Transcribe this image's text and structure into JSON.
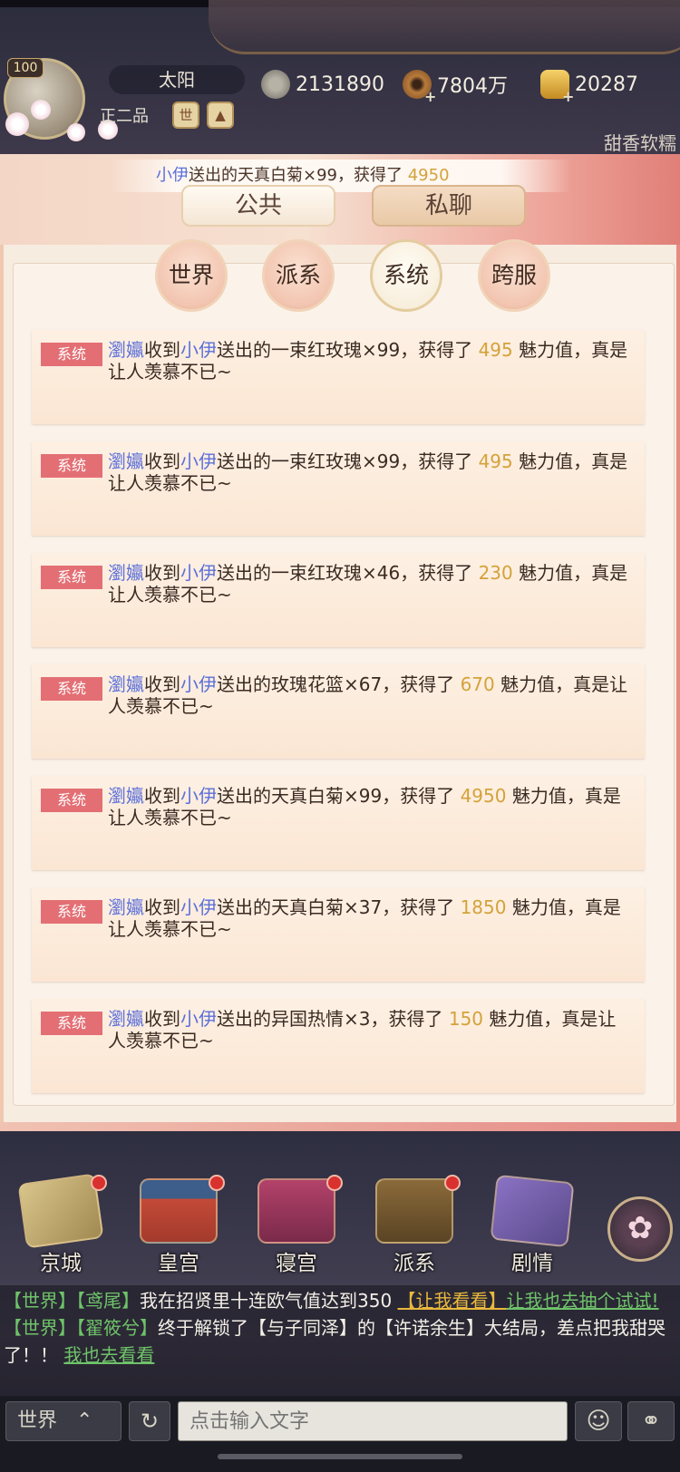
{
  "hud": {
    "level": "100",
    "player_name": "太阳",
    "rank": "正二品",
    "rank_button": "世",
    "rank_up_icon": "up-arrow-icon",
    "silver": "2131890",
    "coins": "7804万",
    "gold": "20287",
    "server": "甜香软糯"
  },
  "ticker": {
    "sender": "小伊",
    "text": "送出的天真白菊×99，获得了",
    "value": "4950"
  },
  "tabs": {
    "public": "公共",
    "private": "私聊"
  },
  "subtabs": [
    {
      "label": "世界",
      "active": false
    },
    {
      "label": "派系",
      "active": false
    },
    {
      "label": "系统",
      "active": true
    },
    {
      "label": "跨服",
      "active": false
    }
  ],
  "messages": [
    {
      "tag": "系统",
      "recipient": "瀏㜲",
      "verb": "收到",
      "sender": "小伊",
      "body": "送出的一束红玫瑰×99，获得了 ",
      "value": "495",
      "tail": " 魅力值，真是让人羡慕不已~"
    },
    {
      "tag": "系统",
      "recipient": "瀏㜲",
      "verb": "收到",
      "sender": "小伊",
      "body": "送出的一束红玫瑰×99，获得了 ",
      "value": "495",
      "tail": " 魅力值，真是让人羡慕不已~"
    },
    {
      "tag": "系统",
      "recipient": "瀏㜲",
      "verb": "收到",
      "sender": "小伊",
      "body": "送出的一束红玫瑰×46，获得了 ",
      "value": "230",
      "tail": " 魅力值，真是让人羡慕不已~"
    },
    {
      "tag": "系统",
      "recipient": "瀏㜲",
      "verb": "收到",
      "sender": "小伊",
      "body": "送出的玫瑰花篮×67，获得了 ",
      "value": "670",
      "tail": " 魅力值，真是让人羡慕不已~"
    },
    {
      "tag": "系统",
      "recipient": "瀏㜲",
      "verb": "收到",
      "sender": "小伊",
      "body": "送出的天真白菊×99，获得了 ",
      "value": "4950",
      "tail": " 魅力值，真是让人羡慕不已~"
    },
    {
      "tag": "系统",
      "recipient": "瀏㜲",
      "verb": "收到",
      "sender": "小伊",
      "body": "送出的天真白菊×37，获得了 ",
      "value": "1850",
      "tail": " 魅力值，真是让人羡慕不已~"
    },
    {
      "tag": "系统",
      "recipient": "瀏㜲",
      "verb": "收到",
      "sender": "小伊",
      "body": "送出的异国热情×3，获得了 ",
      "value": "150",
      "tail": " 魅力值，真是让人羡慕不已~"
    }
  ],
  "nav": [
    {
      "label": "京城",
      "icon": "map-icon"
    },
    {
      "label": "皇宫",
      "icon": "palace-icon"
    },
    {
      "label": "寝宫",
      "icon": "bedchamber-icon"
    },
    {
      "label": "派系",
      "icon": "faction-icon"
    },
    {
      "label": "剧情",
      "icon": "story-book-icon"
    }
  ],
  "feed": [
    {
      "channel": "【世界】",
      "user": "【鸢尾】",
      "text": "我在招贤里十连欧气值达到350",
      "link": "【让我看看】",
      "link2": "让我也去抽个试试!"
    },
    {
      "channel": "【世界】",
      "user": "【翟筱兮】",
      "text": "终于解锁了【与子同泽】的【许诺余生】大结局，差点把我甜哭了！！",
      "link": "我也去看看"
    }
  ],
  "input": {
    "channel": "世界",
    "placeholder": "点击输入文字"
  },
  "colors": {
    "tag_red": "#e36f74",
    "name_blue": "#5b6fd9",
    "value_gold": "#d4a23a",
    "feed_green": "#6fc36a"
  }
}
